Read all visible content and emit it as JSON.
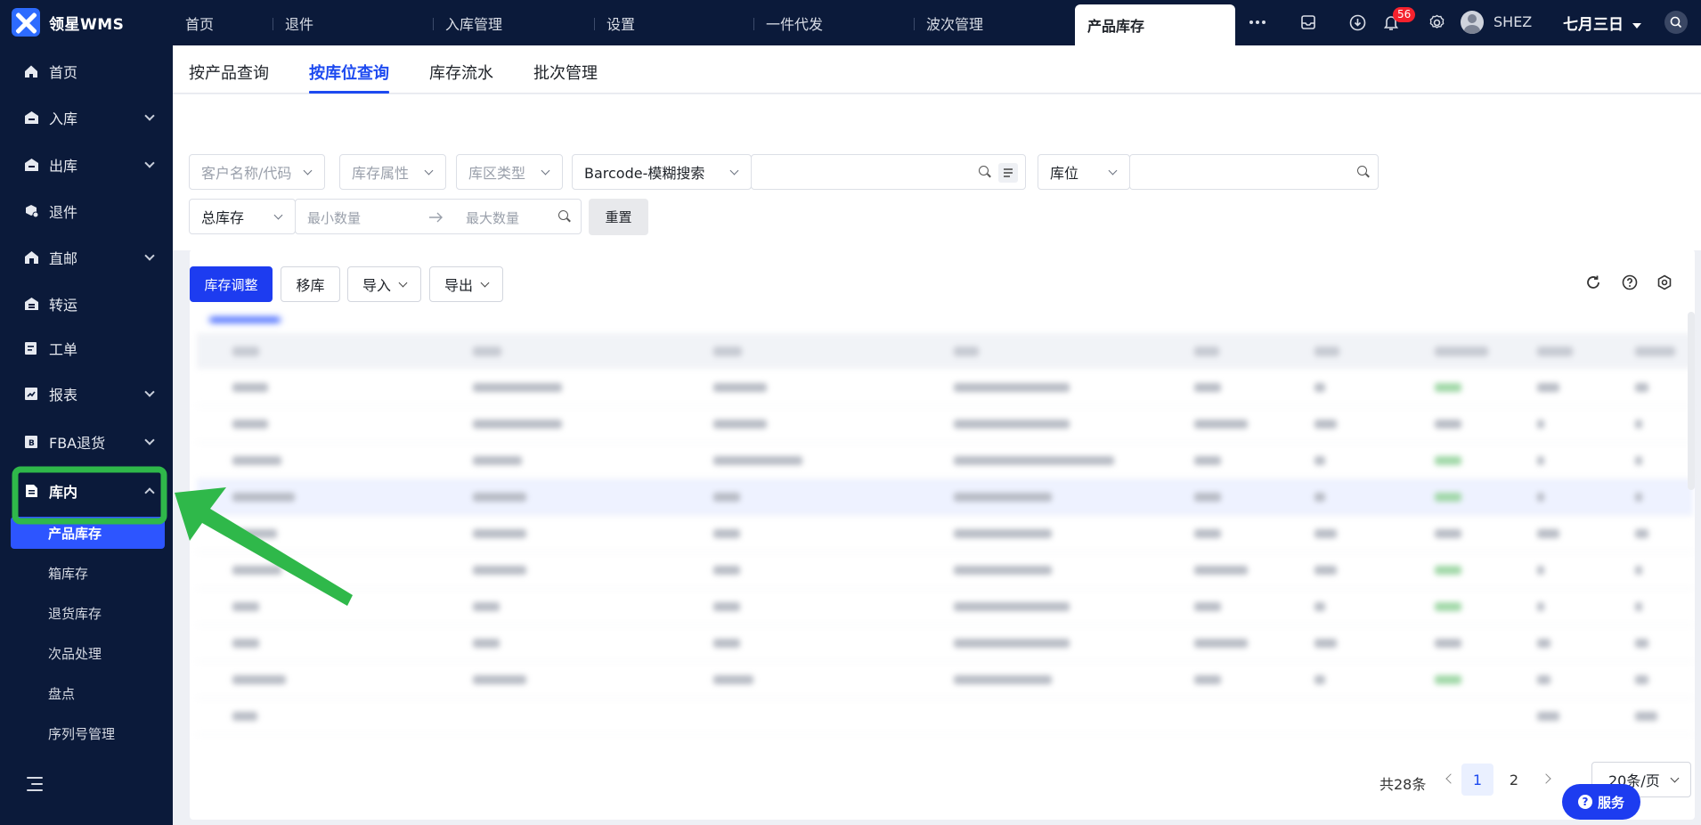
{
  "brand": {
    "name": "领星WMS"
  },
  "top_tabs": [
    {
      "label": "首页"
    },
    {
      "label": "退件"
    },
    {
      "label": "入库管理"
    },
    {
      "label": "设置"
    },
    {
      "label": "一件代发"
    },
    {
      "label": "波次管理"
    },
    {
      "label": "产品库存",
      "active": true
    }
  ],
  "header": {
    "notification_count": "56",
    "username": "SHEZ",
    "date_label": "七月三日"
  },
  "sidebar": {
    "items": [
      {
        "label": "首页",
        "icon": "home-icon"
      },
      {
        "label": "入库",
        "icon": "warehouse-in-icon",
        "expandable": true
      },
      {
        "label": "出库",
        "icon": "warehouse-out-icon",
        "expandable": true
      },
      {
        "label": "退件",
        "icon": "return-icon"
      },
      {
        "label": "直邮",
        "icon": "direct-mail-icon",
        "expandable": true
      },
      {
        "label": "转运",
        "icon": "transfer-icon"
      },
      {
        "label": "工单",
        "icon": "work-order-icon"
      },
      {
        "label": "报表",
        "icon": "report-icon",
        "expandable": true
      },
      {
        "label": "FBA退货",
        "icon": "fba-return-icon",
        "expandable": true
      },
      {
        "label": "库内",
        "icon": "inventory-icon",
        "expanded": true
      }
    ],
    "sub_items": [
      {
        "label": "产品库存",
        "active": true
      },
      {
        "label": "箱库存"
      },
      {
        "label": "退货库存"
      },
      {
        "label": "次品处理"
      },
      {
        "label": "盘点"
      },
      {
        "label": "序列号管理"
      }
    ]
  },
  "subtabs": [
    {
      "label": "按产品查询"
    },
    {
      "label": "按库位查询",
      "active": true
    },
    {
      "label": "库存流水"
    },
    {
      "label": "批次管理"
    }
  ],
  "filters": {
    "customer_placeholder": "客户名称/代码",
    "stock_attr_placeholder": "库存属性",
    "zone_type_placeholder": "库区类型",
    "barcode_mode": "Barcode-模糊搜索",
    "location_mode": "库位",
    "stock_type": "总库存",
    "min_qty_placeholder": "最小数量",
    "max_qty_placeholder": "最大数量",
    "reset_label": "重置"
  },
  "toolbar": {
    "adjust_label": "库存调整",
    "move_label": "移库",
    "import_label": "导入",
    "export_label": "导出"
  },
  "pagination": {
    "total_label": "共28条",
    "pages": [
      "1",
      "2"
    ],
    "current_page": "1",
    "page_size_label": "20条/页"
  },
  "service_button": {
    "label": "服务"
  },
  "colors": {
    "sidebar_bg": "#0b1a3a",
    "primary": "#1d3cf0",
    "highlight_green": "#2fb84a",
    "badge_red": "#f5222d"
  }
}
